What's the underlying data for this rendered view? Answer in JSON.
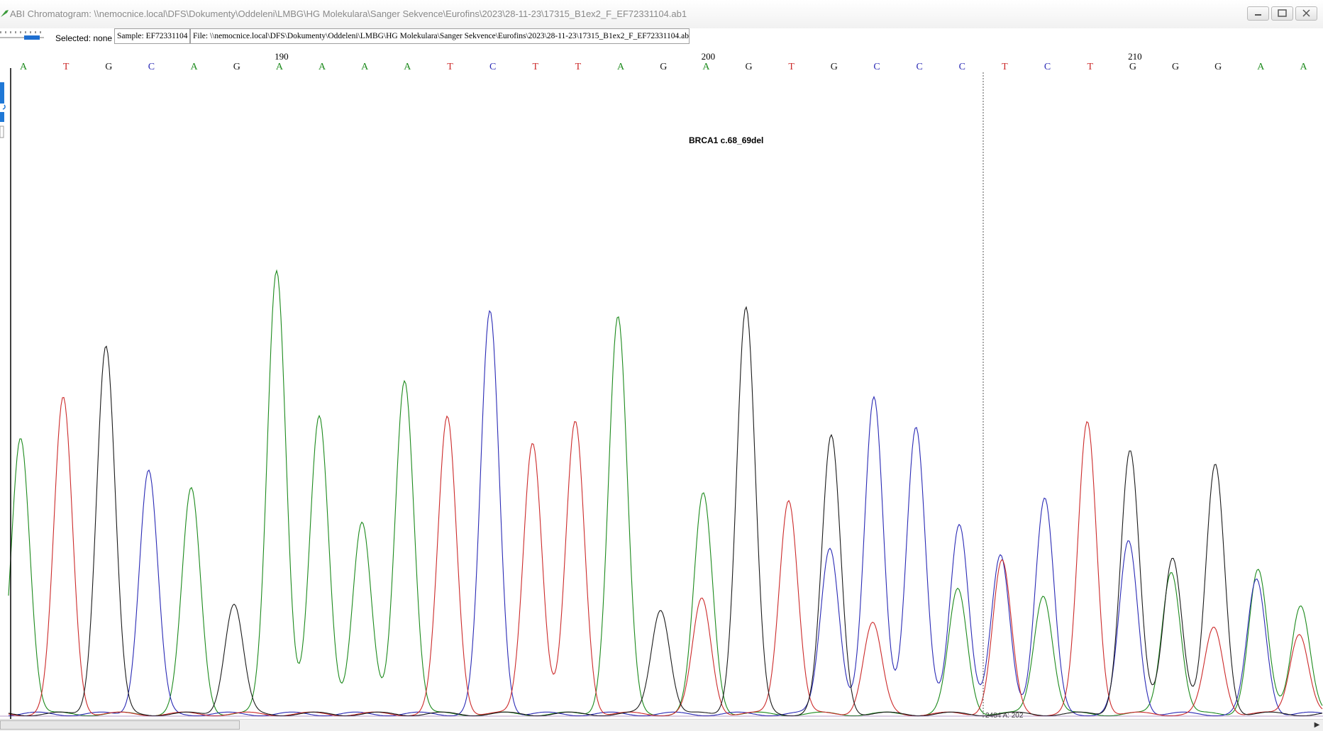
{
  "window": {
    "title": "ABI Chromatogram: \\\\nemocnice.local\\DFS\\Dokumenty\\Oddeleni\\LMBG\\HG Molekulara\\Sanger Sekvence\\Eurofins\\2023\\28-11-23\\17315_B1ex2_F_EF72331104.ab1"
  },
  "toolbar": {
    "selected": "Selected: none",
    "sample": "Sample: EF72331104",
    "file": "File: \\\\nemocnice.local\\DFS\\Dokumenty\\Oddeleni\\LMBG\\HG Molekulara\\Sanger Sekvence\\Eurofins\\2023\\28-11-23\\17315_B1ex2_F_EF72331104.ab1"
  },
  "colors": {
    "A": "#1c8a1c",
    "C": "#2a2ab5",
    "G": "#1a1a1a",
    "T": "#cc2a2a"
  },
  "sequence": {
    "bases": [
      "A",
      "T",
      "G",
      "C",
      "A",
      "G",
      "A",
      "A",
      "A",
      "A",
      "T",
      "C",
      "T",
      "T",
      "A",
      "G",
      "A",
      "G",
      "T",
      "G",
      "C",
      "C",
      "C",
      "T",
      "C",
      "T",
      "G",
      "G",
      "G",
      "A",
      "A"
    ],
    "position_labels": [
      {
        "text": "190",
        "base_index": 6
      },
      {
        "text": "200",
        "base_index": 16
      },
      {
        "text": "210",
        "base_index": 26
      }
    ]
  },
  "annotation": {
    "label": "BRCA1 c.68_69del"
  },
  "status_readout": "2484 A: 202"
}
